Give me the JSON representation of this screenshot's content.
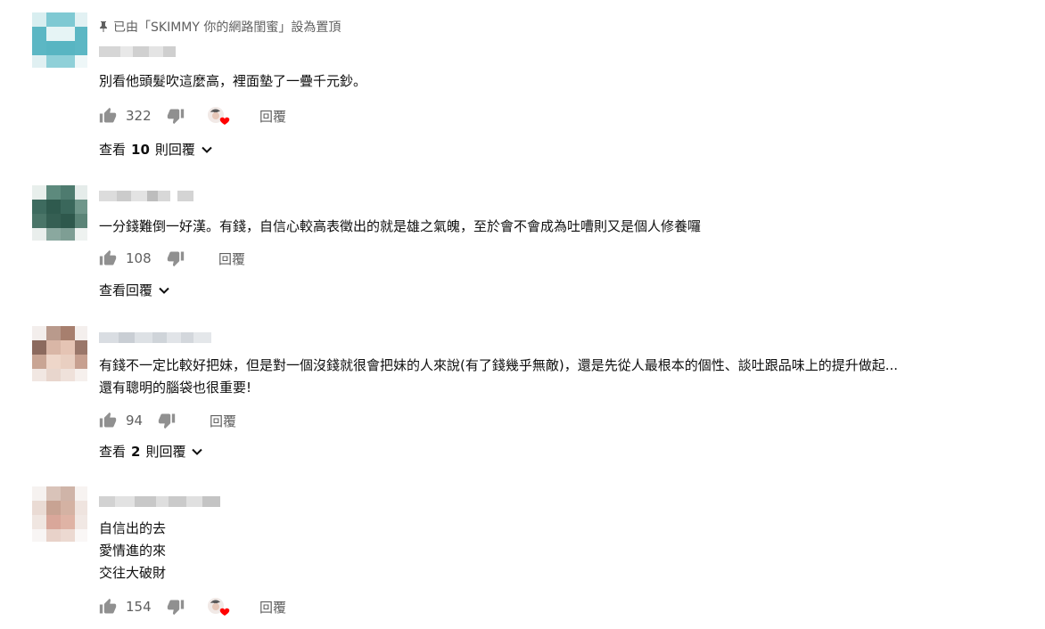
{
  "colors": {
    "text_primary": "#0f0f0f",
    "text_secondary": "#606060",
    "icon": "#606060",
    "heart": "#ff0000"
  },
  "comments": [
    {
      "pinned_label": "已由「SKIMMY 你的網路閨蜜」設為置頂",
      "text_lines": [
        "別看他頭髮吹這麼高，裡面墊了一疊千元鈔。"
      ],
      "like_count": "322",
      "hearted": true,
      "reply_label": "回覆",
      "view_replies": {
        "prefix": "查看",
        "count": "10",
        "suffix": "則回覆"
      }
    },
    {
      "text_lines": [
        "一分錢難倒一好漢。有錢，自信心較高表徵出的就是雄之氣魄，至於會不會成為吐嘈則又是個人修養囉"
      ],
      "like_count": "108",
      "hearted": false,
      "reply_label": "回覆",
      "view_replies": {
        "prefix": "查看回覆",
        "count": "",
        "suffix": ""
      }
    },
    {
      "text_lines": [
        "有錢不一定比較好把妹，但是對一個沒錢就很會把妹的人來說(有了錢幾乎無敵)，還是先從人最根本的個性、談吐跟品味上的提升做起...",
        "還有聰明的腦袋也很重要!"
      ],
      "like_count": "94",
      "hearted": false,
      "reply_label": "回覆",
      "view_replies": {
        "prefix": "查看",
        "count": "2",
        "suffix": "則回覆"
      }
    },
    {
      "text_lines": [
        "自信出的去",
        "愛情進的來",
        "交往大破財"
      ],
      "like_count": "154",
      "hearted": true,
      "reply_label": "回覆"
    }
  ]
}
